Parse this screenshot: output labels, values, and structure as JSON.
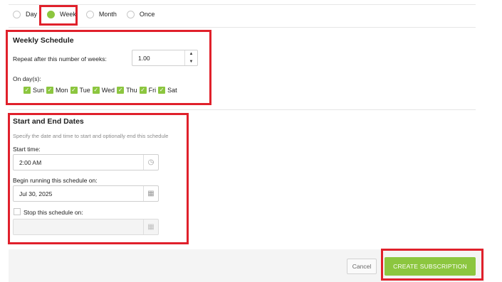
{
  "frequency": {
    "options": [
      {
        "label": "Day",
        "selected": false
      },
      {
        "label": "Week",
        "selected": true
      },
      {
        "label": "Month",
        "selected": false
      },
      {
        "label": "Once",
        "selected": false
      }
    ]
  },
  "weekly": {
    "title": "Weekly Schedule",
    "repeat_label": "Repeat after this number of weeks:",
    "repeat_value": "1.00",
    "days_label": "On day(s):",
    "days": [
      {
        "label": "Sun",
        "checked": true
      },
      {
        "label": "Mon",
        "checked": true
      },
      {
        "label": "Tue",
        "checked": true
      },
      {
        "label": "Wed",
        "checked": true
      },
      {
        "label": "Thu",
        "checked": true
      },
      {
        "label": "Fri",
        "checked": true
      },
      {
        "label": "Sat",
        "checked": true
      }
    ]
  },
  "dates": {
    "title": "Start and End Dates",
    "description": "Specify the date and time to start and optionally end this schedule",
    "start_time_label": "Start time:",
    "start_time_value": "2:00 AM",
    "begin_label": "Begin running this schedule on:",
    "begin_value": "Jul 30, 2025",
    "stop_label": "Stop this schedule on:",
    "stop_checked": false,
    "stop_value": ""
  },
  "footer": {
    "cancel_label": "Cancel",
    "create_label": "CREATE SUBSCRIPTION"
  },
  "colors": {
    "accent": "#8cc63f",
    "highlight": "#e0202b"
  },
  "icons": {
    "stepper_up": "triangle-up",
    "stepper_down": "triangle-down",
    "clock": "clock-icon",
    "calendar": "calendar-icon"
  }
}
